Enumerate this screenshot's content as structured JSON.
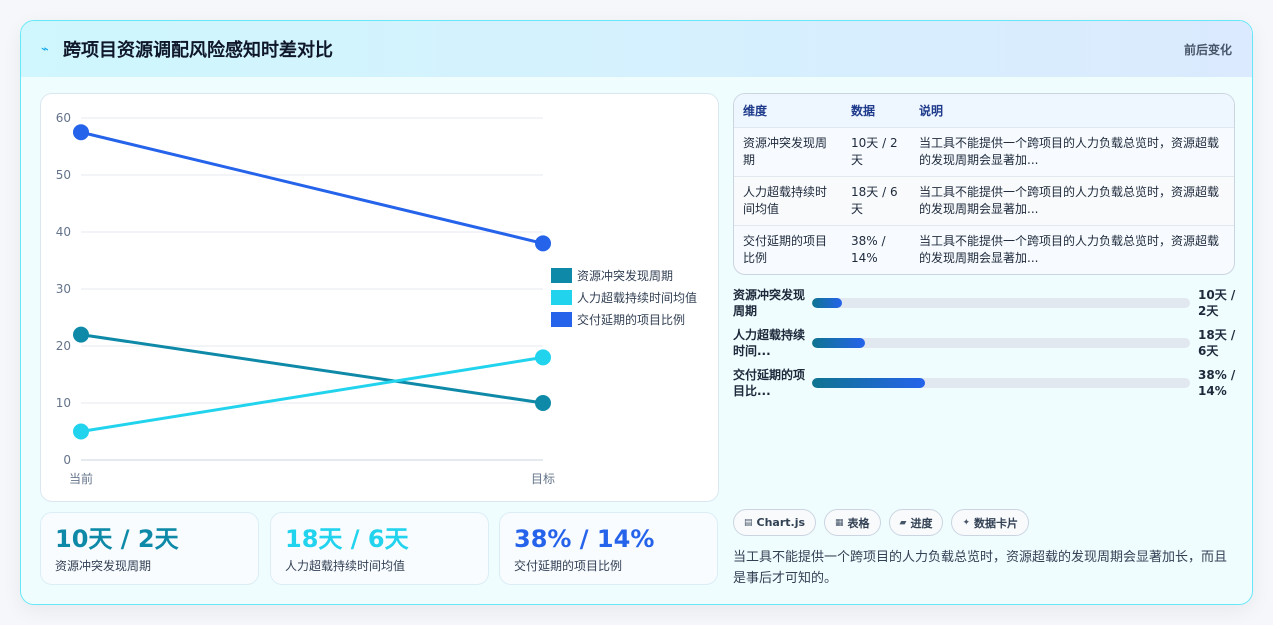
{
  "header": {
    "title": "跨项目资源调配风险感知时差对比",
    "badge": "前后变化"
  },
  "colors": {
    "series1": "#0e8aa8",
    "series2": "#22d3ee",
    "series3": "#2563eb"
  },
  "chart_data": {
    "type": "line",
    "x": [
      "当前",
      "目标"
    ],
    "y_ticks": [
      0,
      10,
      20,
      30,
      40,
      50,
      60
    ],
    "ylim": [
      0,
      60
    ],
    "legend_position": "right",
    "grid": true,
    "series": [
      {
        "name": "资源冲突发现周期",
        "values": [
          22,
          10
        ],
        "color": "#0e8aa8"
      },
      {
        "name": "人力超载持续时间均值",
        "values": [
          5,
          18
        ],
        "color": "#22d3ee"
      },
      {
        "name": "交付延期的项目比例",
        "values": [
          57.5,
          38
        ],
        "color": "#2563eb"
      }
    ]
  },
  "kpis": [
    {
      "value": "10天 / 2天",
      "label": "资源冲突发现周期",
      "color": "#0e8aa8"
    },
    {
      "value": "18天 / 6天",
      "label": "人力超载持续时间均值",
      "color": "#22d3ee"
    },
    {
      "value": "38% / 14%",
      "label": "交付延期的项目比例",
      "color": "#2563eb"
    }
  ],
  "table": {
    "headers": [
      "维度",
      "数据",
      "说明"
    ],
    "rows": [
      {
        "dim": "资源冲突发现周期",
        "data": "10天 / 2天",
        "note": "当工具不能提供一个跨项目的人力负载总览时，资源超载的发现周期会显著加..."
      },
      {
        "dim": "人力超载持续时间均值",
        "data": "18天 / 6天",
        "note": "当工具不能提供一个跨项目的人力负载总览时，资源超载的发现周期会显著加..."
      },
      {
        "dim": "交付延期的项目比例",
        "data": "38% / 14%",
        "note": "当工具不能提供一个跨项目的人力负载总览时，资源超载的发现周期会显著加..."
      }
    ]
  },
  "progress": [
    {
      "label": "资源冲突发现周期",
      "value": "10天 / 2天",
      "fraction": 0.08
    },
    {
      "label": "人力超载持续时间...",
      "value": "18天 / 6天",
      "fraction": 0.14
    },
    {
      "label": "交付延期的项目比...",
      "value": "38% / 14%",
      "fraction": 0.3
    }
  ],
  "tags": [
    {
      "icon": "▤",
      "label": "Chart.js"
    },
    {
      "icon": "▦",
      "label": "表格"
    },
    {
      "icon": "▰",
      "label": "进度"
    },
    {
      "icon": "✦",
      "label": "数据卡片"
    }
  ],
  "description": "当工具不能提供一个跨项目的人力负载总览时，资源超载的发现周期会显著加长，而且是事后才可知的。"
}
